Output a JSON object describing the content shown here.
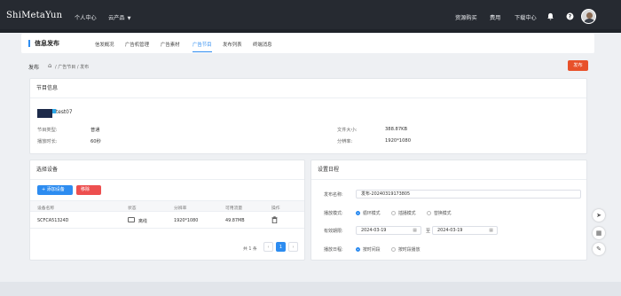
{
  "header": {
    "brand": "ShiMetaYun",
    "nav": [
      "个人中心",
      "云产品"
    ],
    "right_links": [
      "资源购买",
      "费用",
      "下载中心"
    ],
    "icons": [
      "bell-icon",
      "help-icon"
    ]
  },
  "tabs": {
    "title": "信息发布",
    "items": [
      "信发概况",
      "广告机管理",
      "广告素材",
      "广告节目",
      "发布列表",
      "终端消息"
    ],
    "active_index": 3
  },
  "breadcrumb": {
    "title": "发布",
    "path": "/ 广告节目 / 发布",
    "publish_button": "发布"
  },
  "program_info": {
    "title": "节目信息",
    "filename": "test07",
    "fields": [
      {
        "label": "节目类型:",
        "value": "普通"
      },
      {
        "label": "播放时长:",
        "value": "60秒"
      },
      {
        "label": "文件大小:",
        "value": "388.87KB"
      },
      {
        "label": "分辨率:",
        "value": "1920*1080"
      }
    ]
  },
  "device_select": {
    "title": "选择设备",
    "add_button": "+ 添加设备",
    "delete_button": "移除",
    "columns": [
      "设备名称",
      "状态",
      "分辨率",
      "可用流量",
      "操作"
    ],
    "rows": [
      {
        "name": "SCFCA51324D",
        "status": "离线",
        "resolution": "1920*1080",
        "storage": "49.87MB"
      }
    ],
    "pager": {
      "total": "共 1 条",
      "prev": "‹",
      "current": "1",
      "next": "›"
    }
  },
  "schedule": {
    "title": "设置日程",
    "publish_name_label": "发布名称:",
    "publish_name_value": "发布-20240319173805",
    "mode_label": "播放模式:",
    "modes": [
      "循环模式",
      "插播模式",
      "替换模式"
    ],
    "mode_selected": 0,
    "period_label": "有效期限:",
    "date_from": "2024-03-19",
    "date_sep": "至",
    "date_to": "2024-03-19",
    "daily_label": "播放日程:",
    "daily_options": [
      "按时间段",
      "按时段播放"
    ],
    "daily_selected": 0
  },
  "side_tools": [
    "send-icon",
    "qrcode-icon",
    "edit-icon"
  ]
}
